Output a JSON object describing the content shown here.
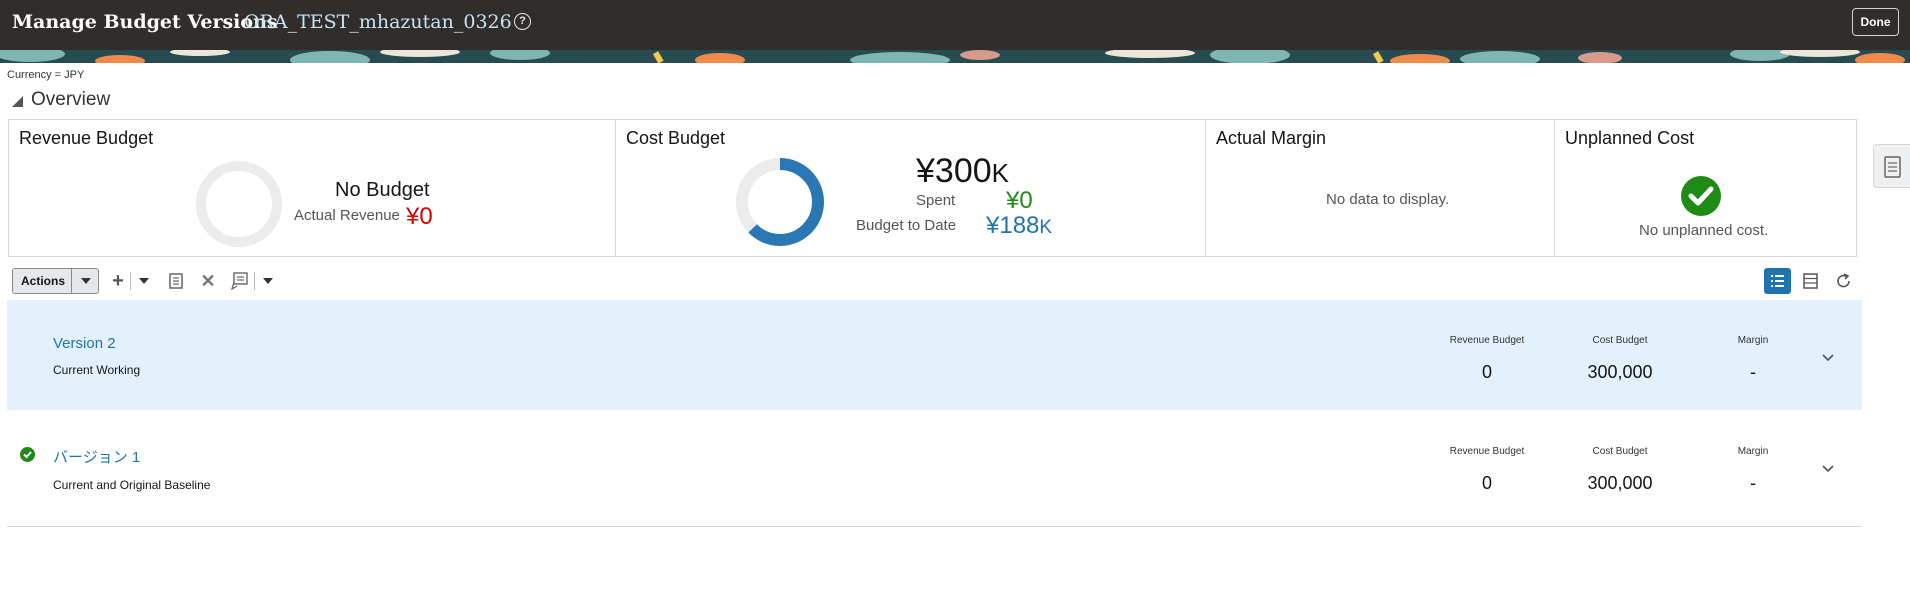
{
  "header": {
    "title": "Manage Budget Versions",
    "project": "ORA_TEST_mhazutan_0326",
    "help_glyph": "?",
    "done_label": "Done",
    "bg_color": "#312d2a"
  },
  "currency_label": "Currency = JPY",
  "overview": {
    "heading": "Overview",
    "cards": {
      "revenue": {
        "title": "Revenue Budget",
        "status": "No Budget",
        "actual_label": "Actual Revenue",
        "actual_value": "¥0"
      },
      "cost": {
        "title": "Cost Budget",
        "total": "¥300",
        "total_suffix": "K",
        "spent_label": "Spent",
        "spent_value": "¥0",
        "btd_label": "Budget to Date",
        "btd_value": "¥188",
        "btd_suffix": "K",
        "donut_fraction": 0.627
      },
      "margin": {
        "title": "Actual Margin",
        "message": "No data to display."
      },
      "unplanned": {
        "title": "Unplanned Cost",
        "message": "No unplanned cost."
      }
    }
  },
  "toolbar": {
    "actions_label": "Actions",
    "icons": [
      "add-icon",
      "dropdown-icon",
      "view-details-icon",
      "delete-icon",
      "edit-comments-icon",
      "dropdown-icon",
      "list-view-icon",
      "table-view-icon",
      "refresh-icon"
    ]
  },
  "versions": [
    {
      "name": "Version 2",
      "status": "Current Working",
      "selected": true,
      "baseline_check": false,
      "columns": [
        {
          "header": "Revenue Budget",
          "value": "0"
        },
        {
          "header": "Cost Budget",
          "value": "300,000"
        },
        {
          "header": "Margin",
          "value": "-"
        }
      ]
    },
    {
      "name": "バージョン 1",
      "status": "Current and Original Baseline",
      "selected": false,
      "baseline_check": true,
      "columns": [
        {
          "header": "Revenue Budget",
          "value": "0"
        },
        {
          "header": "Cost Budget",
          "value": "300,000"
        },
        {
          "header": "Margin",
          "value": "-"
        }
      ]
    }
  ],
  "colors": {
    "link_blue": "#1f73b0",
    "red": "#d60000",
    "green": "#1f8a16",
    "selected_row": "#e3f1fd"
  }
}
